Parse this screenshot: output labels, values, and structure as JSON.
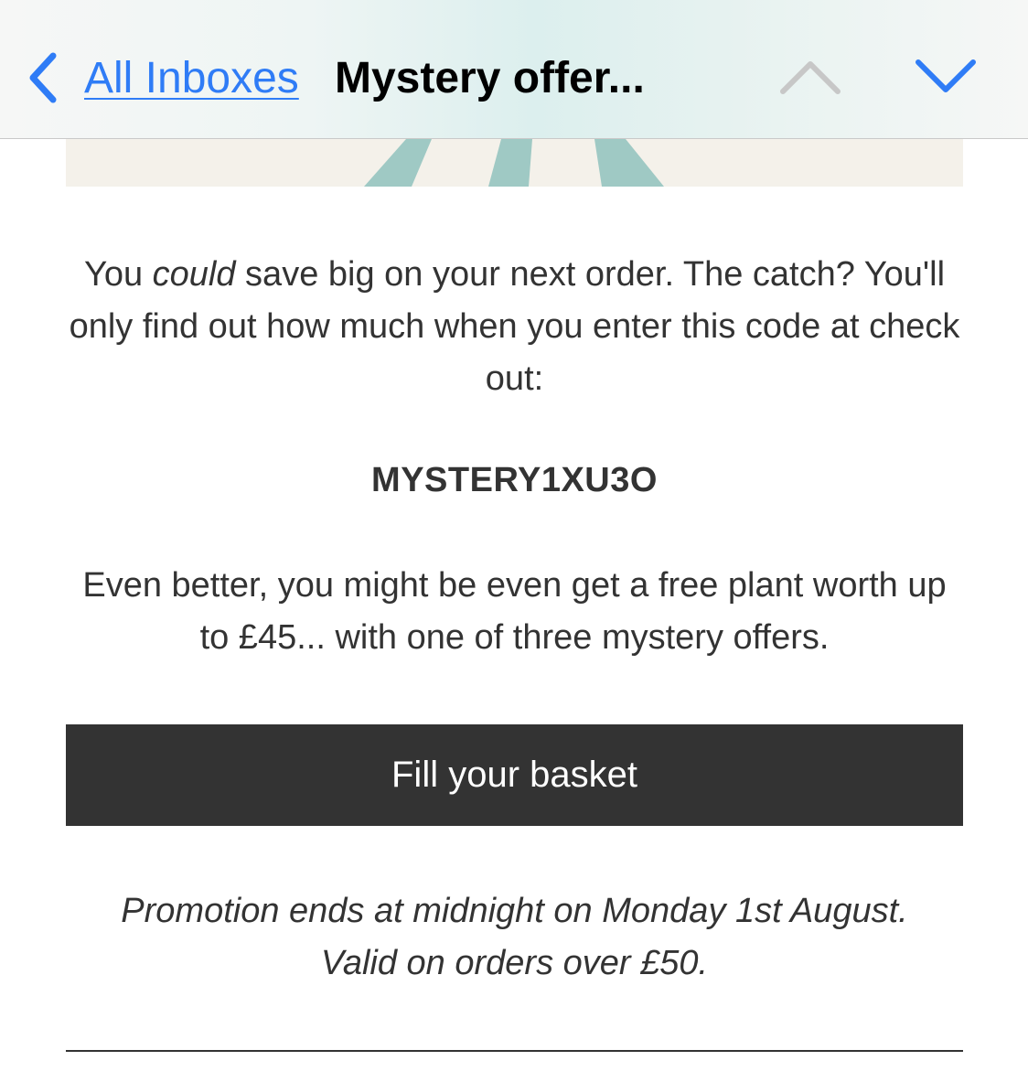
{
  "nav": {
    "back_label": "All Inboxes",
    "subject": "Mystery offer...",
    "icons": {
      "back": "chevron-left-icon",
      "previous": "chevron-up-icon",
      "next": "chevron-down-icon"
    }
  },
  "email": {
    "intro": {
      "before_emphasis": "You ",
      "emphasis": "could",
      "after_emphasis": " save big on your next order. The catch? You'll only find out how much when you enter this code at check out:"
    },
    "promo_code": "MYSTERY1XU3O",
    "bonus_text": "Even better, you might be even get a free plant worth up to £45... with one of three mystery offers.",
    "cta_label": "Fill your basket",
    "terms_line1": "Promotion ends at midnight on Monday 1st August.",
    "terms_line2": "Valid on orders over £50."
  },
  "colors": {
    "link_blue": "#2f7cf6",
    "disabled_chevron": "#c7c7c7",
    "button_bg": "#333333",
    "text": "#333333",
    "hero_bg": "#f4f1ea",
    "hero_teal": "#9fc9c4",
    "hero_dark_teal": "#3a8a7f"
  }
}
